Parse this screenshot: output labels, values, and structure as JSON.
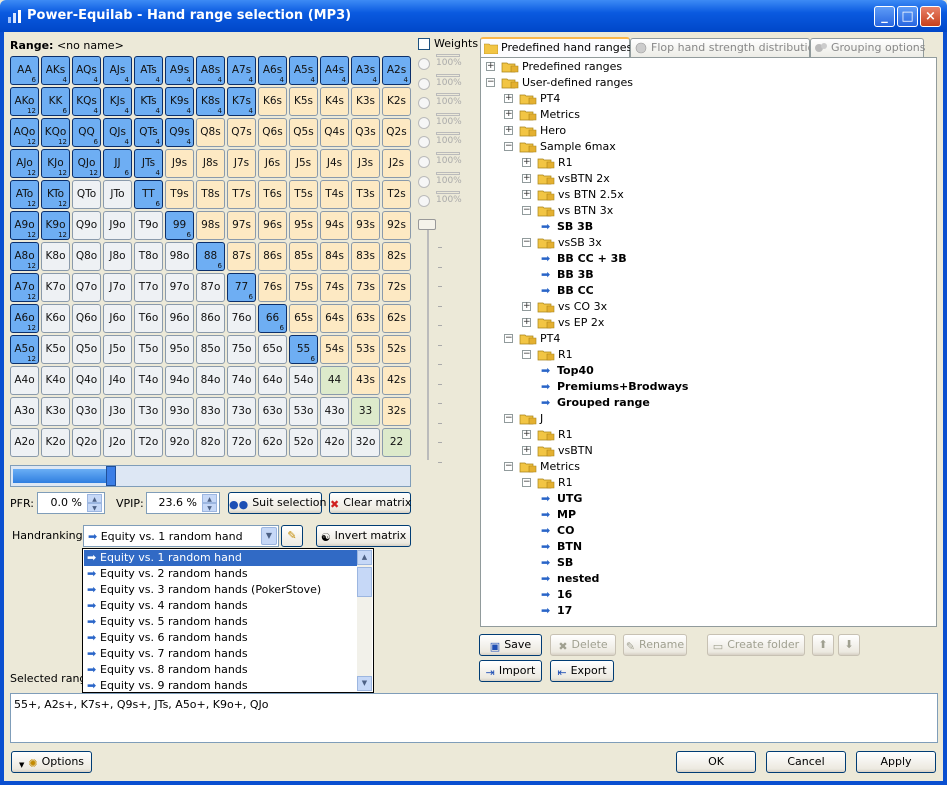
{
  "window": {
    "title": "Power-Equilab - Hand range selection (MP3)"
  },
  "range": {
    "label": "Range:",
    "name": "<no name>"
  },
  "matrix": [
    [
      [
        "AA",
        "6",
        1
      ],
      [
        "AKs",
        "4",
        1
      ],
      [
        "AQs",
        "4",
        1
      ],
      [
        "AJs",
        "4",
        1
      ],
      [
        "ATs",
        "4",
        1
      ],
      [
        "A9s",
        "4",
        1
      ],
      [
        "A8s",
        "4",
        1
      ],
      [
        "A7s",
        "4",
        1
      ],
      [
        "A6s",
        "4",
        1
      ],
      [
        "A5s",
        "4",
        1
      ],
      [
        "A4s",
        "4",
        1
      ],
      [
        "A3s",
        "4",
        1
      ],
      [
        "A2s",
        "4",
        1
      ]
    ],
    [
      [
        "AKo",
        "12",
        1
      ],
      [
        "KK",
        "6",
        1
      ],
      [
        "KQs",
        "4",
        1
      ],
      [
        "KJs",
        "4",
        1
      ],
      [
        "KTs",
        "4",
        1
      ],
      [
        "K9s",
        "4",
        1
      ],
      [
        "K8s",
        "4",
        1
      ],
      [
        "K7s",
        "4",
        1
      ],
      [
        "K6s",
        "",
        0
      ],
      [
        "K5s",
        "",
        0
      ],
      [
        "K4s",
        "",
        0
      ],
      [
        "K3s",
        "",
        0
      ],
      [
        "K2s",
        "",
        0
      ]
    ],
    [
      [
        "AQo",
        "12",
        1
      ],
      [
        "KQo",
        "12",
        1
      ],
      [
        "QQ",
        "6",
        1
      ],
      [
        "QJs",
        "4",
        1
      ],
      [
        "QTs",
        "4",
        1
      ],
      [
        "Q9s",
        "4",
        1
      ],
      [
        "Q8s",
        "",
        0
      ],
      [
        "Q7s",
        "",
        0
      ],
      [
        "Q6s",
        "",
        0
      ],
      [
        "Q5s",
        "",
        0
      ],
      [
        "Q4s",
        "",
        0
      ],
      [
        "Q3s",
        "",
        0
      ],
      [
        "Q2s",
        "",
        0
      ]
    ],
    [
      [
        "AJo",
        "12",
        1
      ],
      [
        "KJo",
        "12",
        1
      ],
      [
        "QJo",
        "12",
        1
      ],
      [
        "JJ",
        "6",
        1
      ],
      [
        "JTs",
        "4",
        1
      ],
      [
        "J9s",
        "",
        0
      ],
      [
        "J8s",
        "",
        0
      ],
      [
        "J7s",
        "",
        0
      ],
      [
        "J6s",
        "",
        0
      ],
      [
        "J5s",
        "",
        0
      ],
      [
        "J4s",
        "",
        0
      ],
      [
        "J3s",
        "",
        0
      ],
      [
        "J2s",
        "",
        0
      ]
    ],
    [
      [
        "ATo",
        "12",
        1
      ],
      [
        "KTo",
        "12",
        1
      ],
      [
        "QTo",
        "",
        0
      ],
      [
        "JTo",
        "",
        0
      ],
      [
        "TT",
        "6",
        1
      ],
      [
        "T9s",
        "",
        0
      ],
      [
        "T8s",
        "",
        0
      ],
      [
        "T7s",
        "",
        0
      ],
      [
        "T6s",
        "",
        0
      ],
      [
        "T5s",
        "",
        0
      ],
      [
        "T4s",
        "",
        0
      ],
      [
        "T3s",
        "",
        0
      ],
      [
        "T2s",
        "",
        0
      ]
    ],
    [
      [
        "A9o",
        "12",
        1
      ],
      [
        "K9o",
        "12",
        1
      ],
      [
        "Q9o",
        "",
        0
      ],
      [
        "J9o",
        "",
        0
      ],
      [
        "T9o",
        "",
        0
      ],
      [
        "99",
        "6",
        1
      ],
      [
        "98s",
        "",
        0
      ],
      [
        "97s",
        "",
        0
      ],
      [
        "96s",
        "",
        0
      ],
      [
        "95s",
        "",
        0
      ],
      [
        "94s",
        "",
        0
      ],
      [
        "93s",
        "",
        0
      ],
      [
        "92s",
        "",
        0
      ]
    ],
    [
      [
        "A8o",
        "12",
        1
      ],
      [
        "K8o",
        "",
        0
      ],
      [
        "Q8o",
        "",
        0
      ],
      [
        "J8o",
        "",
        0
      ],
      [
        "T8o",
        "",
        0
      ],
      [
        "98o",
        "",
        0
      ],
      [
        "88",
        "6",
        1
      ],
      [
        "87s",
        "",
        0
      ],
      [
        "86s",
        "",
        0
      ],
      [
        "85s",
        "",
        0
      ],
      [
        "84s",
        "",
        0
      ],
      [
        "83s",
        "",
        0
      ],
      [
        "82s",
        "",
        0
      ]
    ],
    [
      [
        "A7o",
        "12",
        1
      ],
      [
        "K7o",
        "",
        0
      ],
      [
        "Q7o",
        "",
        0
      ],
      [
        "J7o",
        "",
        0
      ],
      [
        "T7o",
        "",
        0
      ],
      [
        "97o",
        "",
        0
      ],
      [
        "87o",
        "",
        0
      ],
      [
        "77",
        "6",
        1
      ],
      [
        "76s",
        "",
        0
      ],
      [
        "75s",
        "",
        0
      ],
      [
        "74s",
        "",
        0
      ],
      [
        "73s",
        "",
        0
      ],
      [
        "72s",
        "",
        0
      ]
    ],
    [
      [
        "A6o",
        "12",
        1
      ],
      [
        "K6o",
        "",
        0
      ],
      [
        "Q6o",
        "",
        0
      ],
      [
        "J6o",
        "",
        0
      ],
      [
        "T6o",
        "",
        0
      ],
      [
        "96o",
        "",
        0
      ],
      [
        "86o",
        "",
        0
      ],
      [
        "76o",
        "",
        0
      ],
      [
        "66",
        "6",
        1
      ],
      [
        "65s",
        "",
        0
      ],
      [
        "64s",
        "",
        0
      ],
      [
        "63s",
        "",
        0
      ],
      [
        "62s",
        "",
        0
      ]
    ],
    [
      [
        "A5o",
        "12",
        1
      ],
      [
        "K5o",
        "",
        0
      ],
      [
        "Q5o",
        "",
        0
      ],
      [
        "J5o",
        "",
        0
      ],
      [
        "T5o",
        "",
        0
      ],
      [
        "95o",
        "",
        0
      ],
      [
        "85o",
        "",
        0
      ],
      [
        "75o",
        "",
        0
      ],
      [
        "65o",
        "",
        0
      ],
      [
        "55",
        "6",
        1
      ],
      [
        "54s",
        "",
        0
      ],
      [
        "53s",
        "",
        0
      ],
      [
        "52s",
        "",
        0
      ]
    ],
    [
      [
        "A4o",
        "",
        0
      ],
      [
        "K4o",
        "",
        0
      ],
      [
        "Q4o",
        "",
        0
      ],
      [
        "J4o",
        "",
        0
      ],
      [
        "T4o",
        "",
        0
      ],
      [
        "94o",
        "",
        0
      ],
      [
        "84o",
        "",
        0
      ],
      [
        "74o",
        "",
        0
      ],
      [
        "64o",
        "",
        0
      ],
      [
        "54o",
        "",
        0
      ],
      [
        "44",
        "",
        0
      ],
      [
        "43s",
        "",
        0
      ],
      [
        "42s",
        "",
        0
      ]
    ],
    [
      [
        "A3o",
        "",
        0
      ],
      [
        "K3o",
        "",
        0
      ],
      [
        "Q3o",
        "",
        0
      ],
      [
        "J3o",
        "",
        0
      ],
      [
        "T3o",
        "",
        0
      ],
      [
        "93o",
        "",
        0
      ],
      [
        "83o",
        "",
        0
      ],
      [
        "73o",
        "",
        0
      ],
      [
        "63o",
        "",
        0
      ],
      [
        "53o",
        "",
        0
      ],
      [
        "43o",
        "",
        0
      ],
      [
        "33",
        "",
        0
      ],
      [
        "32s",
        "",
        0
      ]
    ],
    [
      [
        "A2o",
        "",
        0
      ],
      [
        "K2o",
        "",
        0
      ],
      [
        "Q2o",
        "",
        0
      ],
      [
        "J2o",
        "",
        0
      ],
      [
        "T2o",
        "",
        0
      ],
      [
        "92o",
        "",
        0
      ],
      [
        "82o",
        "",
        0
      ],
      [
        "72o",
        "",
        0
      ],
      [
        "62o",
        "",
        0
      ],
      [
        "52o",
        "",
        0
      ],
      [
        "42o",
        "",
        0
      ],
      [
        "32o",
        "",
        0
      ],
      [
        "22",
        "",
        0
      ]
    ]
  ],
  "weights": {
    "label": "Weights",
    "rows": [
      "100%",
      "100%",
      "100%",
      "100%",
      "100%",
      "100%",
      "100%",
      "100%"
    ]
  },
  "range_slider": {
    "value_fraction": 0.236
  },
  "pfr": {
    "label": "PFR:",
    "value": "0.0 %"
  },
  "vpip": {
    "label": "VPIP:",
    "value": "23.6 %"
  },
  "buttons": {
    "suit_selection": "Suit selection",
    "clear_matrix": "Clear matrix",
    "invert_matrix": "Invert matrix",
    "save": "Save",
    "delete": "Delete",
    "rename": "Rename",
    "create_folder": "Create folder",
    "import": "Import",
    "export": "Export",
    "options": "Options",
    "ok": "OK",
    "cancel": "Cancel",
    "apply": "Apply"
  },
  "handranking": {
    "label": "Handranking:",
    "selected": "Equity vs. 1 random hand",
    "options": [
      "Equity vs. 1 random hand",
      "Equity vs. 2 random hands",
      "Equity vs. 3 random hands (PokerStove)",
      "Equity vs. 4 random hands",
      "Equity vs. 5 random hands",
      "Equity vs. 6 random hands",
      "Equity vs. 7 random hands",
      "Equity vs. 8 random hands",
      "Equity vs. 9 random hands"
    ]
  },
  "selected_range": {
    "label": "Selected range",
    "value": "55+, A2s+, K7s+, Q9s+, JTs, A5o+, K9o+, QJo"
  },
  "tabs": [
    "Predefined hand ranges",
    "Flop hand strength distribution",
    "Grouping options"
  ],
  "tree": [
    {
      "d": 0,
      "t": "Predefined ranges",
      "k": "folder",
      "e": "+"
    },
    {
      "d": 0,
      "t": "User-defined ranges",
      "k": "folder",
      "e": "-"
    },
    {
      "d": 1,
      "t": "PT4",
      "k": "folder",
      "e": "+"
    },
    {
      "d": 1,
      "t": "Metrics",
      "k": "folder",
      "e": "+"
    },
    {
      "d": 1,
      "t": "Hero",
      "k": "folder",
      "e": "+"
    },
    {
      "d": 1,
      "t": "Sample 6max",
      "k": "folder",
      "e": "-"
    },
    {
      "d": 2,
      "t": "R1",
      "k": "folder",
      "e": "+"
    },
    {
      "d": 2,
      "t": "vsBTN 2x",
      "k": "folder",
      "e": "+"
    },
    {
      "d": 2,
      "t": "vs BTN 2.5x",
      "k": "folder",
      "e": "+"
    },
    {
      "d": 2,
      "t": "vs BTN 3x",
      "k": "folder",
      "e": "-"
    },
    {
      "d": 3,
      "t": "SB 3B",
      "k": "range"
    },
    {
      "d": 2,
      "t": "vsSB 3x",
      "k": "folder",
      "e": "-"
    },
    {
      "d": 3,
      "t": "BB CC + 3B",
      "k": "range"
    },
    {
      "d": 3,
      "t": "BB 3B",
      "k": "range"
    },
    {
      "d": 3,
      "t": "BB CC",
      "k": "range"
    },
    {
      "d": 2,
      "t": "vs CO 3x",
      "k": "folder",
      "e": "+"
    },
    {
      "d": 2,
      "t": "vs EP 2x",
      "k": "folder",
      "e": "+"
    },
    {
      "d": 1,
      "t": "PT4",
      "k": "folder",
      "e": "-"
    },
    {
      "d": 2,
      "t": "R1",
      "k": "folder",
      "e": "-"
    },
    {
      "d": 3,
      "t": "Top40",
      "k": "range"
    },
    {
      "d": 3,
      "t": "Premiums+Brodways",
      "k": "range"
    },
    {
      "d": 3,
      "t": "Grouped range",
      "k": "range"
    },
    {
      "d": 1,
      "t": "J",
      "k": "folder",
      "e": "-"
    },
    {
      "d": 2,
      "t": "R1",
      "k": "folder",
      "e": "+"
    },
    {
      "d": 2,
      "t": "vsBTN",
      "k": "folder",
      "e": "+"
    },
    {
      "d": 1,
      "t": "Metrics",
      "k": "folder",
      "e": "-"
    },
    {
      "d": 2,
      "t": "R1",
      "k": "folder",
      "e": "-"
    },
    {
      "d": 3,
      "t": "UTG",
      "k": "range"
    },
    {
      "d": 3,
      "t": "MP",
      "k": "range"
    },
    {
      "d": 3,
      "t": "CO",
      "k": "range"
    },
    {
      "d": 3,
      "t": "BTN",
      "k": "range"
    },
    {
      "d": 3,
      "t": "SB",
      "k": "range"
    },
    {
      "d": 3,
      "t": "nested",
      "k": "range"
    },
    {
      "d": 3,
      "t": "16",
      "k": "range"
    },
    {
      "d": 3,
      "t": "17",
      "k": "range"
    }
  ],
  "colors": {
    "selected": "#6eaef3",
    "pair": "#ddeacb",
    "suited": "#fde9c3",
    "offsuit": "#eef1f4",
    "accent": "#316ac5"
  }
}
